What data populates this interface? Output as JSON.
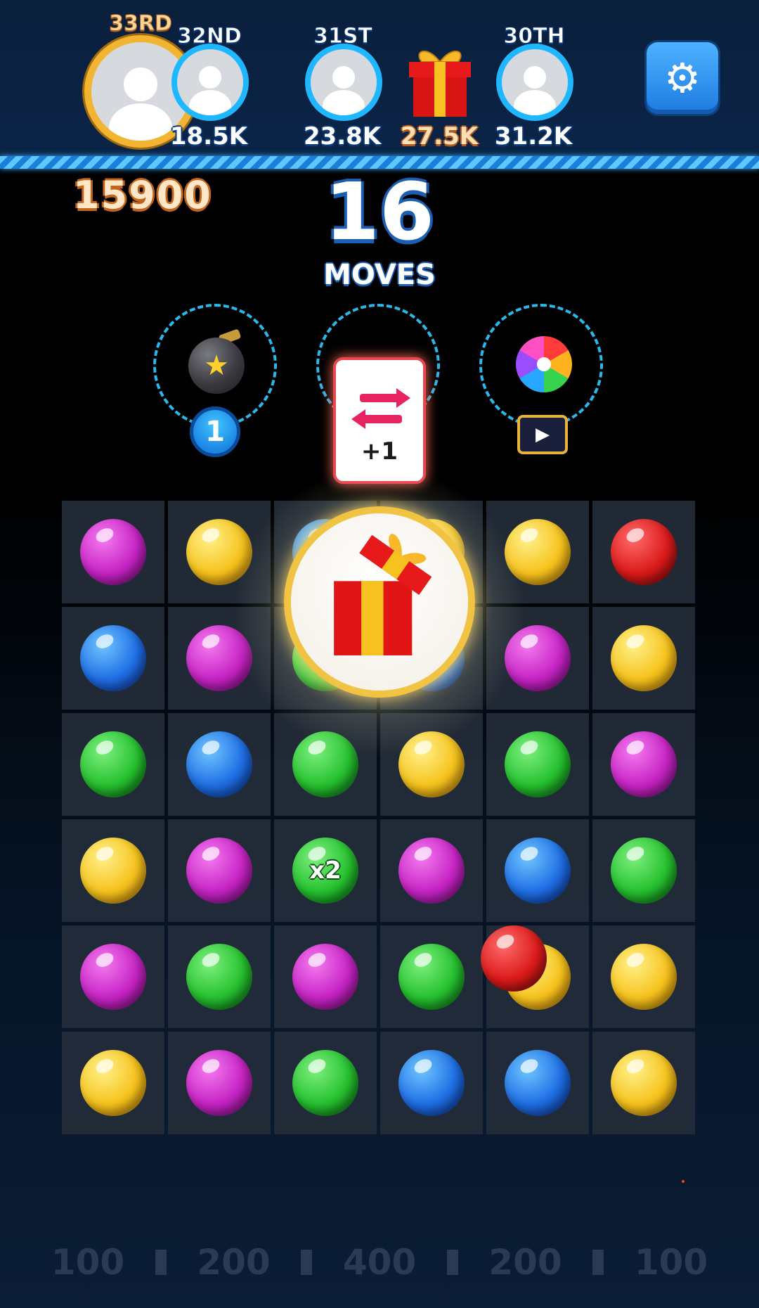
{
  "leaderboard": {
    "me": {
      "rank": "33RD"
    },
    "players": [
      {
        "rank": "32ND",
        "score": "18.5K"
      },
      {
        "rank": "31ST",
        "score": "23.8K"
      },
      {
        "rank": "30TH",
        "score": "31.2K"
      }
    ],
    "reward": {
      "score": "27.5K",
      "icon": "gift-icon"
    }
  },
  "settings": {
    "icon": "gear-icon",
    "glyph": "⚙"
  },
  "game": {
    "score": "15900",
    "moves": "16",
    "moves_label": "MOVES"
  },
  "boosters": [
    {
      "name": "bomb",
      "icon": "bomb-icon",
      "count": "1"
    },
    {
      "name": "swap",
      "icon": "swap-arrows-icon",
      "reward": "+1"
    },
    {
      "name": "color-burst",
      "icon": "pinwheel-icon",
      "unlock": "watch-video-icon",
      "unlock_glyph": "▶"
    }
  ],
  "board": {
    "rows": [
      [
        "purple",
        "yellow",
        "blue",
        "yellow",
        "yellow",
        "red"
      ],
      [
        "blue",
        "purple",
        "green",
        "blue",
        "purple",
        "yellow"
      ],
      [
        "green",
        "blue",
        "green",
        "yellow",
        "green",
        "purple"
      ],
      [
        "yellow",
        "purple",
        "green",
        "purple",
        "blue",
        "green"
      ],
      [
        "purple",
        "green",
        "purple",
        "green",
        "yellow",
        "yellow"
      ],
      [
        "yellow",
        "purple",
        "green",
        "blue",
        "blue",
        "yellow"
      ]
    ],
    "multiplier": {
      "row": 3,
      "col": 2,
      "label": "x2"
    },
    "falling_ball": "red"
  },
  "popup": {
    "icon": "gift-box-icon"
  },
  "bottom_multipliers": [
    "100",
    "200",
    "400",
    "200",
    "100"
  ],
  "colors": {
    "purple": "#c624c4",
    "yellow": "#f6c31d",
    "blue": "#1f6fe5",
    "red": "#db1a1a",
    "green": "#26c12f",
    "accent": "#1fb7ff"
  }
}
